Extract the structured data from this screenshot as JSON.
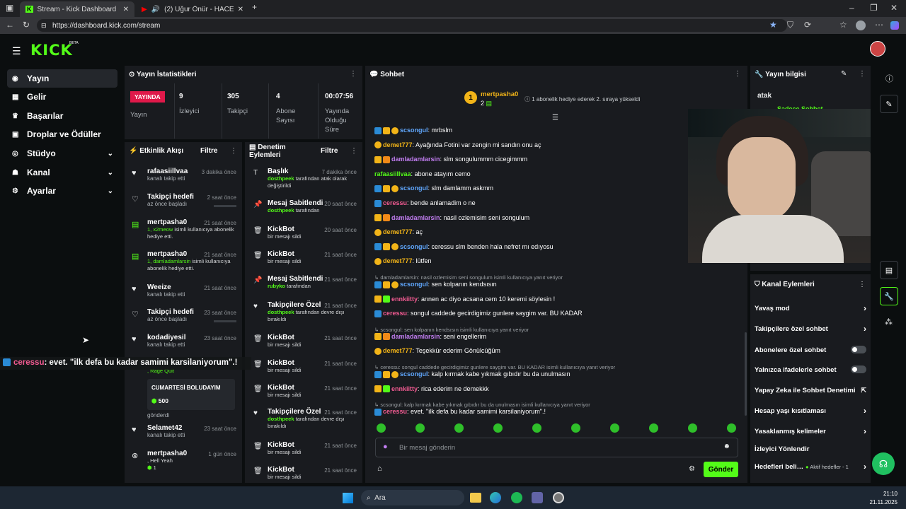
{
  "browser": {
    "tabs": [
      {
        "label": "Stream - Kick Dashboard"
      },
      {
        "label": "(2) Uğur Önür - HACEL OBA…"
      }
    ],
    "url": "https://dashboard.kick.com/stream"
  },
  "app": {
    "logo": "KICK",
    "beta": "BETA"
  },
  "sidebar": {
    "items": [
      {
        "label": "Yayın",
        "icon": "broadcast-icon"
      },
      {
        "label": "Gelir",
        "icon": "revenue-icon"
      },
      {
        "label": "Başarılar",
        "icon": "trophy-icon"
      },
      {
        "label": "Droplar ve Ödüller",
        "icon": "gift-icon"
      },
      {
        "label": "Stüdyo",
        "icon": "studio-icon"
      },
      {
        "label": "Kanal",
        "icon": "channel-icon"
      },
      {
        "label": "Ayarlar",
        "icon": "gear-icon"
      }
    ]
  },
  "stats": {
    "title": "Yayın İstatistikleri",
    "live_badge": "YAYINDA",
    "live_label": "Yayın",
    "viewers": "9",
    "viewers_label": "İzleyici",
    "followers": "305",
    "followers_label": "Takipçi",
    "subs": "4",
    "subs_label": "Abone Sayısı",
    "uptime": "00:07:56",
    "uptime_label": "Yayında Olduğu Süre"
  },
  "activity": {
    "title": "Etkinlik Akışı",
    "filter": "Filtre",
    "items": [
      {
        "title": "rafaasiillvaa",
        "time": "3 dakika önce",
        "sub": "kanalı takip etti"
      },
      {
        "title": "Takipçi hedefi",
        "time": "2 saat önce",
        "sub": "az önce başladı"
      },
      {
        "title": "mertpasha0",
        "time": "21 saat önce",
        "sub_green": "1, x2meow",
        "sub": "isimli kullanıcıya abonelik hediye etti."
      },
      {
        "title": "mertpasha0",
        "time": "21 saat önce",
        "sub_green": "1, damladamlarsin",
        "sub": "isimli kullanıcıya abonelik hediye etti."
      },
      {
        "title": "Weeize",
        "time": "21 saat önce",
        "sub": "kanalı takip etti"
      },
      {
        "title": "Takipçi hedefi",
        "time": "23 saat önce",
        "sub": "az önce başladı"
      },
      {
        "title": "kodadiyesil",
        "time": "23 saat önce",
        "sub": "kanalı takip etti"
      },
      {
        "title": ", Rage Quit",
        "sub": "CUMARTESİ BOLUDAYIM",
        "kicks": "500",
        "sub2": "gönderdi"
      },
      {
        "title": "Selamet42",
        "time": "23 saat önce",
        "sub": "kanalı takip etti"
      },
      {
        "title": "mertpasha0",
        "time": "1 gün önce",
        "sub_green": ", Hell Yeah",
        "kicks": "1"
      }
    ]
  },
  "moderation": {
    "title": "Denetim Eylemleri",
    "filter": "Filtre",
    "items": [
      {
        "title": "Başlık",
        "time": "7 dakika önce",
        "sub_green": "dosthpeek",
        "sub": "tarafından atak olarak değiştirildi"
      },
      {
        "title": "Mesaj Sabitlendi",
        "time": "20 saat önce",
        "sub_green": "dosthpeek",
        "sub": "tarafından"
      },
      {
        "title": "KickBot",
        "time": "20 saat önce",
        "sub": "bir mesajı sildi"
      },
      {
        "title": "KickBot",
        "time": "21 saat önce",
        "sub": "bir mesajı sildi"
      },
      {
        "title": "Mesaj Sabitlendi",
        "time": "21 saat önce",
        "sub_green": "rubyko",
        "sub": "tarafından"
      },
      {
        "title": "Takipçilere Özel",
        "time": "21 saat önce",
        "sub_green": "dosthpeek",
        "sub": "tarafından devre dışı bırakıldı"
      },
      {
        "title": "KickBot",
        "time": "21 saat önce",
        "sub": "bir mesajı sildi"
      },
      {
        "title": "KickBot",
        "time": "21 saat önce",
        "sub": "bir mesajı sildi"
      },
      {
        "title": "KickBot",
        "time": "21 saat önce",
        "sub": "bir mesajı sildi"
      },
      {
        "title": "Takipçilere Özel",
        "time": "21 saat önce",
        "sub_green": "dosthpeek",
        "sub": "tarafından devre dışı bırakıldı"
      },
      {
        "title": "KickBot",
        "time": "21 saat önce",
        "sub": "bir mesajı sildi"
      },
      {
        "title": "KickBot",
        "time": "21 saat önce",
        "sub": "bir mesajı sildi"
      }
    ]
  },
  "chat": {
    "title": "Sohbet",
    "pinned_user": "mertpasha0",
    "pinned_count": "2",
    "pinned_note": "1 abonelik hediye ederek 2. sıraya yükseldi",
    "messages": [
      {
        "user": "scsongul",
        "text": "mrbslm"
      },
      {
        "user": "demet777",
        "text": "Ayağında Fotini var zengin mi sandın onu aç"
      },
      {
        "user": "damladamlarsin",
        "text": "slm songulummm cicegimmm"
      },
      {
        "user": "rafaasiillvaa",
        "text": "abone atayım cemo"
      },
      {
        "user": "scsongul",
        "text": "slm damlamm askmm"
      },
      {
        "user": "ceressu",
        "text": "bende anlamadim o ne"
      },
      {
        "user": "damladamlarsin",
        "text": "nasil ozlemisim seni songulum"
      },
      {
        "user": "demet777",
        "text": "aç"
      },
      {
        "user": "scsongul",
        "text": "ceressu slm benden hala nefret mı edıyosu"
      },
      {
        "user": "demet777",
        "text": "lütfen"
      },
      {
        "reply": "damladamlarsin: nasil ozlemisim seni songulum isimli kullanıcıya yanıt veriyor"
      },
      {
        "user": "scsongul",
        "text": "sen kolpanın kendsısın"
      },
      {
        "user": "ennkiitty",
        "text": "annen ac diyo acsana cem 10 keremi söylesin !"
      },
      {
        "user": "ceressu",
        "text": "songul caddede gecirdigimiz gunlere saygim var. BU KADAR"
      },
      {
        "reply": "scsongul: sen kolpanın kendsısın isimli kullanıcıya yanıt veriyor"
      },
      {
        "user": "damladamlarsin",
        "text": "seni engellerim"
      },
      {
        "user": "demet777",
        "text": "Teşekkür ederim Gönülcüğüm"
      },
      {
        "reply": "ceressu: songul caddede gecirdigimiz gunlere saygim var. BU KADAR isimli kullanıcıya yanıt veriyor"
      },
      {
        "user": "scsongul",
        "text": "kalp kırmak kabe yıkmak gıbıdır bu da unulmasın"
      },
      {
        "user": "ennkiitty",
        "text": "rica ederim ne demekkk"
      },
      {
        "reply": "scsongul: kalp kırmak kabe yıkmak gıbıdır bu da unulmasın isimli kullanıcıya yanıt veriyor"
      },
      {
        "user": "ceressu",
        "text": "evet. \"ilk defa bu kadar samimi karsilaniyorum\".!"
      }
    ],
    "input_placeholder": "Bir mesaj gönderin",
    "send": "Gönder"
  },
  "overlay": {
    "user": "ceressu",
    "text": ": evet. \"ilk defa bu kadar samimi karsilaniyorum\".!"
  },
  "stream_info": {
    "title": "Yayın bilgisi",
    "stream_title": "atak",
    "category": "Sadece Sohbet"
  },
  "channel_actions": {
    "title": "Kanal Eylemleri",
    "items": [
      {
        "label": "Yavaş mod"
      },
      {
        "label": "Takipçilere özel sohbet"
      },
      {
        "label": "Abonelere özel sohbet"
      },
      {
        "label": "Yalnızca ifadelerle sohbet"
      },
      {
        "label": "Yapay Zeka ile Sohbet Denetimi"
      },
      {
        "label": "Hesap yaşı kısıtlaması"
      },
      {
        "label": "Yasaklanmış kelimeler"
      },
      {
        "label": "İzleyici Yönlendir"
      },
      {
        "label": "Hedefleri beli…",
        "extra": "Aktif hedefler - 1"
      }
    ]
  },
  "taskbar": {
    "search": "Ara",
    "time": "21:10",
    "date": "21.11.2025"
  },
  "colors": {
    "accent": "#53fc18",
    "live": "#e0194a",
    "panel": "#191b1f"
  }
}
